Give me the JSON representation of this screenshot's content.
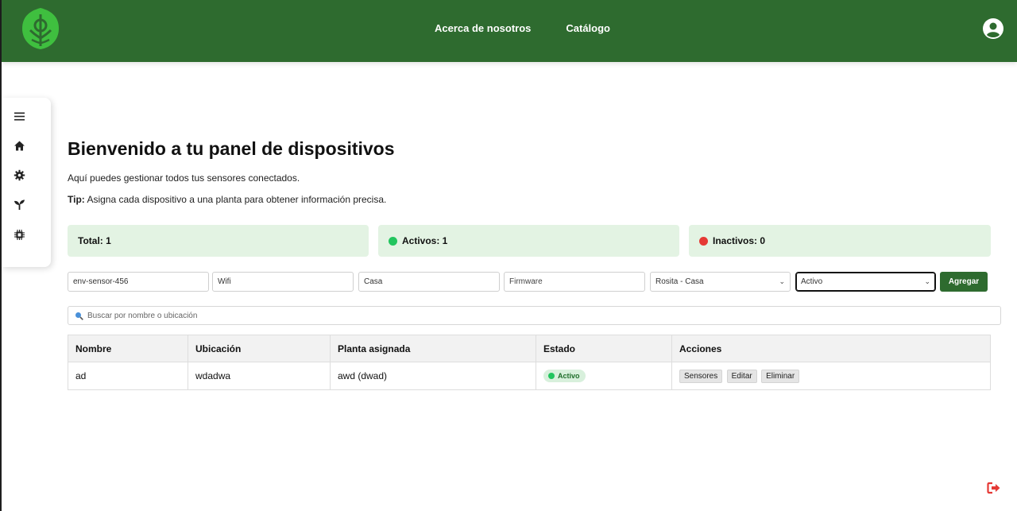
{
  "header": {
    "nav": [
      "Acerca de nosotros",
      "Catálogo"
    ]
  },
  "sidebar": {
    "items": [
      "menu-icon",
      "home-icon",
      "gear-icon",
      "plant-icon",
      "chip-icon"
    ]
  },
  "main": {
    "title": "Bienvenido a tu panel de dispositivos",
    "subtitle": "Aquí puedes gestionar todos tus sensores conectados.",
    "tip_label": "Tip:",
    "tip_text": " Asigna cada dispositivo a una planta para obtener información precisa."
  },
  "stats": {
    "total": "Total: 1",
    "active": "Activos: 1",
    "inactive": "Inactivos: 0"
  },
  "form": {
    "name": "env-sensor-456",
    "connection": "Wifi",
    "location": "Casa",
    "firmware_placeholder": "Firmware",
    "plant": "Rosita - Casa",
    "status": "Activo",
    "add_label": "Agregar"
  },
  "search": {
    "placeholder": "Buscar por nombre o ubicación"
  },
  "table": {
    "headers": [
      "Nombre",
      "Ubicación",
      "Planta asignada",
      "Estado",
      "Acciones"
    ],
    "rows": [
      {
        "name": "ad",
        "location": "wdadwa",
        "plant": "awd (dwad)",
        "status": "Activo",
        "actions": [
          "Sensores",
          "Editar",
          "Eliminar"
        ]
      }
    ]
  },
  "colors": {
    "brand": "#2e6b2f",
    "logo": "#3fbf3f",
    "active_dot": "#22c55e",
    "inactive_dot": "#e53935",
    "stat_bg": "#e3f3e3"
  }
}
